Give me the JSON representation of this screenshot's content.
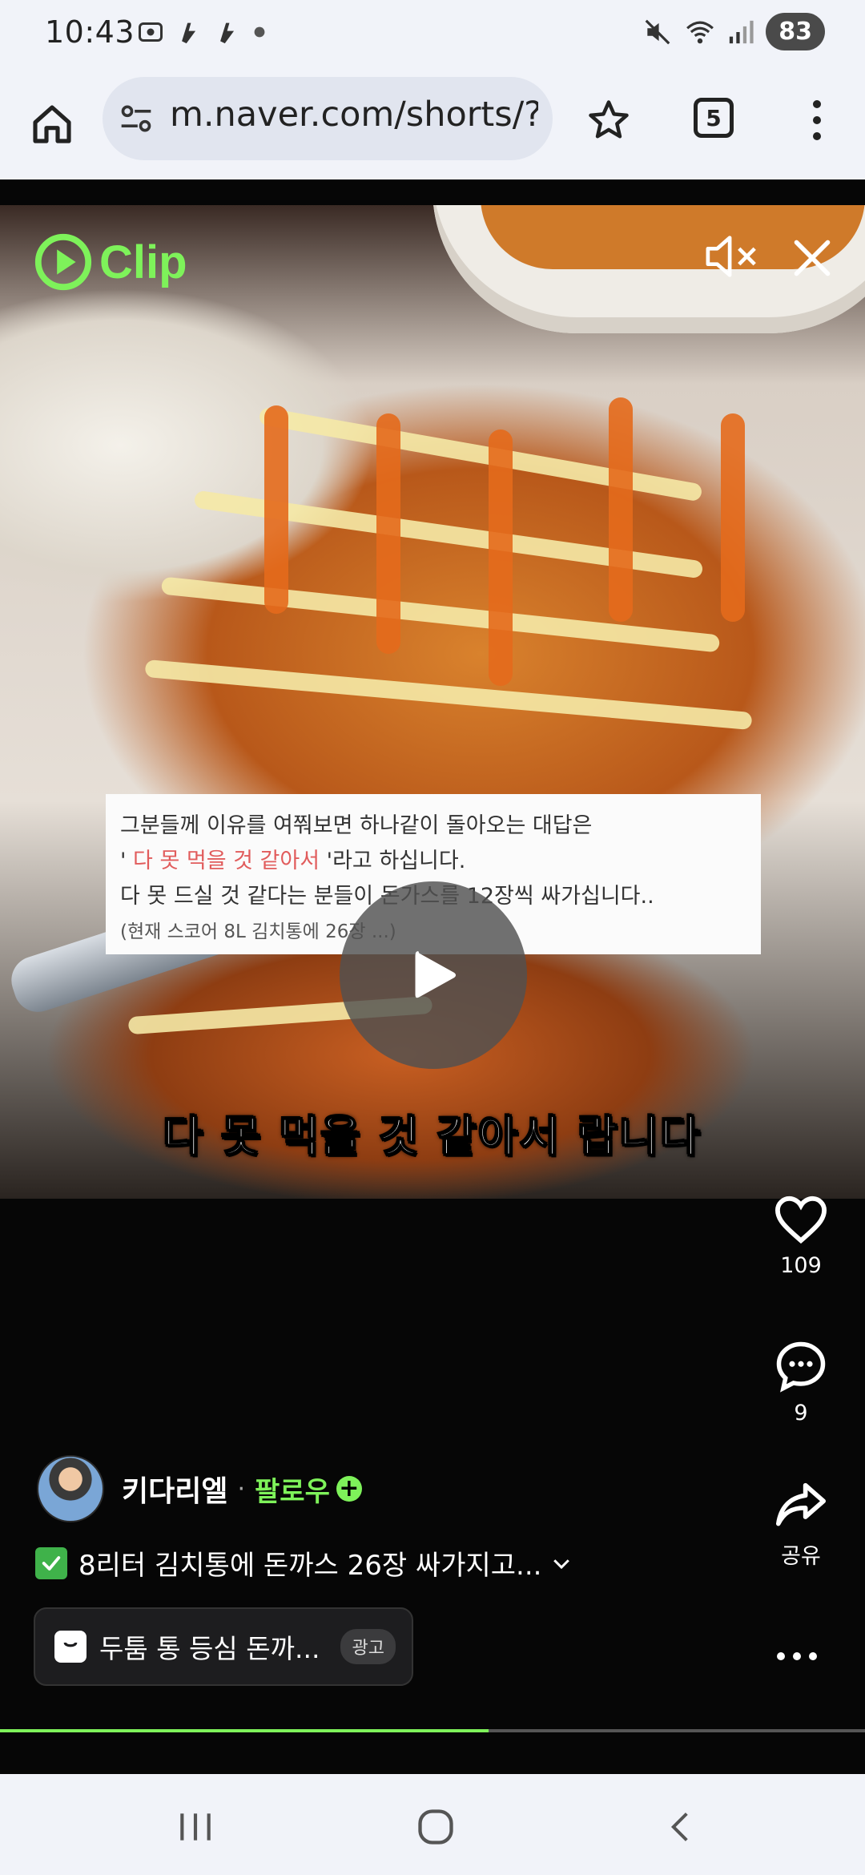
{
  "status_bar": {
    "time": "10:43",
    "battery": "83"
  },
  "browser": {
    "url": "m.naver.com/shorts/?r",
    "tab_count": "5"
  },
  "player": {
    "logo_text": "Clip",
    "accent_color": "#7ef25a",
    "progress": 0.565
  },
  "video_overlay": {
    "caption_line1": "그분들께 이유를 여쭤보면 하나같이 돌아오는 대답은",
    "caption_line2_quote_open": "'",
    "caption_line2_highlight": " 다 못 먹을 것 같아서 ",
    "caption_line2_rest": "'라고 하십니다.",
    "caption_line3": "다 못 드실 것 같다는 분들이 돈가스를 12장씩 싸가십니다..",
    "caption_line4": "(현재 스코어 8L 김치통에 26장 ...)",
    "subtitle": "다 못 먹을 것 같아서 랍니다"
  },
  "actions": {
    "like_count": "109",
    "comment_count": "9",
    "share_label": "공유"
  },
  "author": {
    "name": "키다리엘",
    "separator": "·",
    "follow_label": "팔로우",
    "follow_plus": "+"
  },
  "description": {
    "text": "8리터 김치통에 돈까스 26장 싸가지고...",
    "expand_icon": "chevron-down-icon"
  },
  "ad": {
    "title": "두툼 통 등심 돈까...",
    "badge": "광고"
  }
}
